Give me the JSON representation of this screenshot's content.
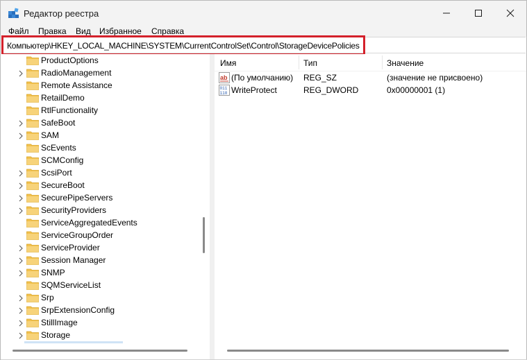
{
  "window": {
    "title": "Редактор реестра"
  },
  "menu": [
    "Файл",
    "Правка",
    "Вид",
    "Избранное",
    "Справка"
  ],
  "address": {
    "path": "Компьютер\\HKEY_LOCAL_MACHINE\\SYSTEM\\CurrentControlSet\\Control\\StorageDevicePolicies",
    "highlight_color": "#d4212b"
  },
  "tree": {
    "items": [
      {
        "label": "ProductOptions",
        "expandable": false
      },
      {
        "label": "RadioManagement",
        "expandable": true
      },
      {
        "label": "Remote Assistance",
        "expandable": false
      },
      {
        "label": "RetailDemo",
        "expandable": false
      },
      {
        "label": "RtlFunctionality",
        "expandable": false
      },
      {
        "label": "SafeBoot",
        "expandable": true
      },
      {
        "label": "SAM",
        "expandable": true
      },
      {
        "label": "ScEvents",
        "expandable": false
      },
      {
        "label": "SCMConfig",
        "expandable": false
      },
      {
        "label": "ScsiPort",
        "expandable": true
      },
      {
        "label": "SecureBoot",
        "expandable": true
      },
      {
        "label": "SecurePipeServers",
        "expandable": true
      },
      {
        "label": "SecurityProviders",
        "expandable": true
      },
      {
        "label": "ServiceAggregatedEvents",
        "expandable": false
      },
      {
        "label": "ServiceGroupOrder",
        "expandable": false
      },
      {
        "label": "ServiceProvider",
        "expandable": true
      },
      {
        "label": "Session Manager",
        "expandable": true
      },
      {
        "label": "SNMP",
        "expandable": true
      },
      {
        "label": "SQMServiceList",
        "expandable": false
      },
      {
        "label": "Srp",
        "expandable": true
      },
      {
        "label": "SrpExtensionConfig",
        "expandable": true
      },
      {
        "label": "StillImage",
        "expandable": true
      },
      {
        "label": "Storage",
        "expandable": true
      }
    ],
    "folder_color": "#f2c14e"
  },
  "values": {
    "headers": {
      "name": "Имя",
      "type": "Тип",
      "data": "Значение"
    },
    "rows": [
      {
        "icon": "string-value-icon",
        "name": "(По умолчанию)",
        "type": "REG_SZ",
        "data": "(значение не присвоено)"
      },
      {
        "icon": "binary-value-icon",
        "name": "WriteProtect",
        "type": "REG_DWORD",
        "data": "0x00000001 (1)"
      }
    ]
  }
}
